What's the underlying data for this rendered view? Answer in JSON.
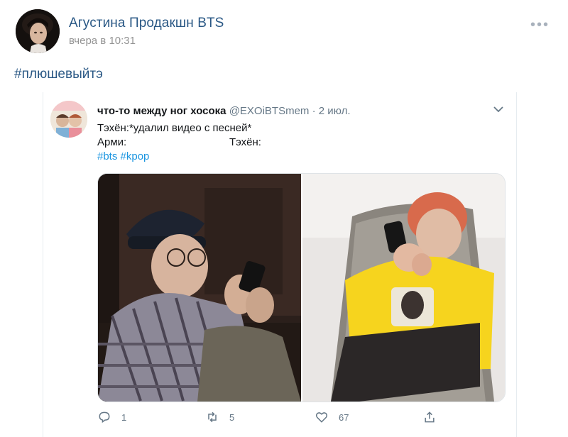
{
  "post": {
    "author": "Агустина Продакшн BTS",
    "time": "вчера в 10:31",
    "hashtag": "#плюшевыйтэ",
    "more_icon": "more-dots-icon"
  },
  "tweet": {
    "name": "что-то между ног хосока",
    "handle": "@EXOiBTSmem · 2 июл.",
    "line1": "Тэхён:*удалил видео с песней*",
    "line2_left": "Арми:",
    "line2_right": "Тэхён:",
    "tag1": "#bts",
    "tag2": "#kpop",
    "actions": {
      "reply_count": "1",
      "retweet_count": "5",
      "like_count": "67"
    }
  },
  "colors": {
    "link": "#2a5885",
    "twitter_blue": "#1b95e0",
    "muted": "#657786"
  }
}
